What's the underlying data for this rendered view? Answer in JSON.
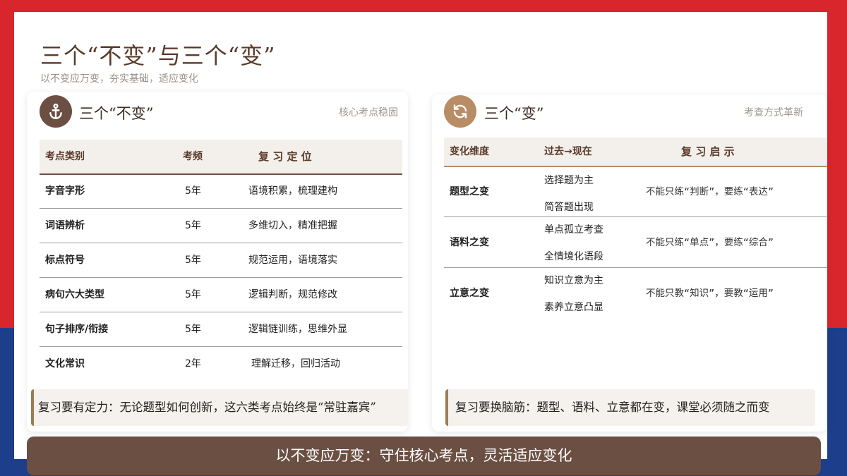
{
  "header": {
    "title": "三个“不变”与三个“变”",
    "subtitle": "以不变应万变，夯实基础，适应变化"
  },
  "left": {
    "icon": "anchor-icon",
    "title": "三个“不变”",
    "tag": "核心考点稳固",
    "columns": [
      "考点类别",
      "考频",
      "复 习 定 位"
    ],
    "rows": [
      {
        "category": "字音字形",
        "freq": "5年",
        "position": "语境积累，梳理建构"
      },
      {
        "category": "词语辨析",
        "freq": "5年",
        "position": "多维切入，精准把握"
      },
      {
        "category": "标点符号",
        "freq": "5年",
        "position": "规范运用，语境落实"
      },
      {
        "category": "病句六大类型",
        "freq": "5年",
        "position": "逻辑判断，规范修改"
      },
      {
        "category": "句子排序/衔接",
        "freq": "5年",
        "position": "逻辑链训练，思维外显"
      },
      {
        "category": "文化常识",
        "freq": "2年",
        "position": "理解迁移，回归活动"
      }
    ],
    "note": "复习要有定力：无论题型如何创新，这六类考点始终是“常驻嘉宾”"
  },
  "right": {
    "icon": "refresh-icon",
    "title": "三个“变”",
    "tag": "考查方式革新",
    "columns": [
      "变化维度",
      "过去→现在",
      "复 习 启 示"
    ],
    "rows": [
      {
        "dimension": "题型之变",
        "past": "选择题为主",
        "now": "简答题出现",
        "insight": "不能只练“判断”，要练“表达”"
      },
      {
        "dimension": "语料之变",
        "past": "单点孤立考查",
        "now": "全情境化语段",
        "insight": "不能只练“单点”，要练“综合”"
      },
      {
        "dimension": "立意之变",
        "past": "知识立意为主",
        "now": "素养立意凸显",
        "insight": "不能只教“知识”，要教“运用”"
      }
    ],
    "note": "复习要换脑筋：题型、语料、立意都在变，课堂必须随之而变"
  },
  "footer": {
    "text": "以不变应万变：守住核心考点，灵活适应变化"
  },
  "colors": {
    "frame_red": "#d9262c",
    "frame_blue": "#1d3f8b",
    "brown": "#6b4f42",
    "tan": "#b88c65"
  }
}
